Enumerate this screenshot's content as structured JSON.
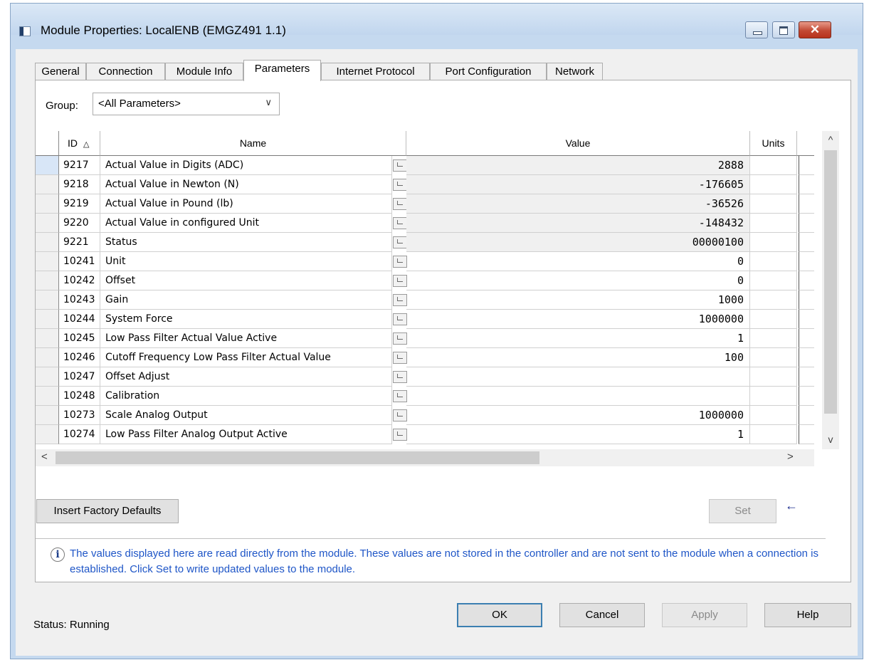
{
  "window": {
    "title": "Module Properties: LocalENB (EMGZ491 1.1)",
    "close_glyph": "✕"
  },
  "tabs": [
    {
      "label": "General",
      "active": false
    },
    {
      "label": "Connection",
      "active": false
    },
    {
      "label": "Module Info",
      "active": false
    },
    {
      "label": "Parameters",
      "active": true
    },
    {
      "label": "Internet Protocol",
      "active": false
    },
    {
      "label": "Port Configuration",
      "active": false
    },
    {
      "label": "Network",
      "active": false
    }
  ],
  "group": {
    "label": "Group:",
    "selected": "<All Parameters>"
  },
  "grid": {
    "columns": {
      "id": "ID",
      "sort_glyph": "△",
      "name": "Name",
      "value": "Value",
      "units": "Units"
    },
    "rows": [
      {
        "id": "9217",
        "name": "Actual Value in Digits (ADC)",
        "value": "2888",
        "readonly": true
      },
      {
        "id": "9218",
        "name": "Actual Value in Newton (N)",
        "value": "-176605",
        "readonly": true
      },
      {
        "id": "9219",
        "name": "Actual Value in Pound (lb)",
        "value": "-36526",
        "readonly": true
      },
      {
        "id": "9220",
        "name": "Actual Value in configured Unit",
        "value": "-148432",
        "readonly": true
      },
      {
        "id": "9221",
        "name": "Status",
        "value": "00000100",
        "readonly": true
      },
      {
        "id": "10241",
        "name": "Unit",
        "value": "0",
        "readonly": false
      },
      {
        "id": "10242",
        "name": "Offset",
        "value": "0",
        "readonly": false
      },
      {
        "id": "10243",
        "name": "Gain",
        "value": "1000",
        "readonly": false
      },
      {
        "id": "10244",
        "name": "System Force",
        "value": "1000000",
        "readonly": false
      },
      {
        "id": "10245",
        "name": "Low Pass Filter Actual Value Active",
        "value": "1",
        "readonly": false
      },
      {
        "id": "10246",
        "name": "Cutoff Frequency Low Pass Filter Actual Value",
        "value": "100",
        "readonly": false
      },
      {
        "id": "10247",
        "name": "Offset Adjust",
        "value": "",
        "readonly": false
      },
      {
        "id": "10248",
        "name": "Calibration",
        "value": "",
        "readonly": false
      },
      {
        "id": "10273",
        "name": "Scale Analog Output",
        "value": "1000000",
        "readonly": false
      },
      {
        "id": "10274",
        "name": "Low Pass Filter Analog Output Active",
        "value": "1",
        "readonly": false
      }
    ]
  },
  "scroll": {
    "up": "^",
    "down": "v",
    "left": "<",
    "right": ">"
  },
  "buttons": {
    "insert_factory_defaults": "Insert Factory Defaults",
    "set": "Set",
    "set_arrow": "←",
    "ok": "OK",
    "cancel": "Cancel",
    "apply": "Apply",
    "help": "Help"
  },
  "info": {
    "icon": "i",
    "text": "The values displayed here are read directly from the module. These values are not stored in the controller and are not sent to the module when a connection is established.  Click Set to write updated values to the module."
  },
  "status": "Status:  Running"
}
